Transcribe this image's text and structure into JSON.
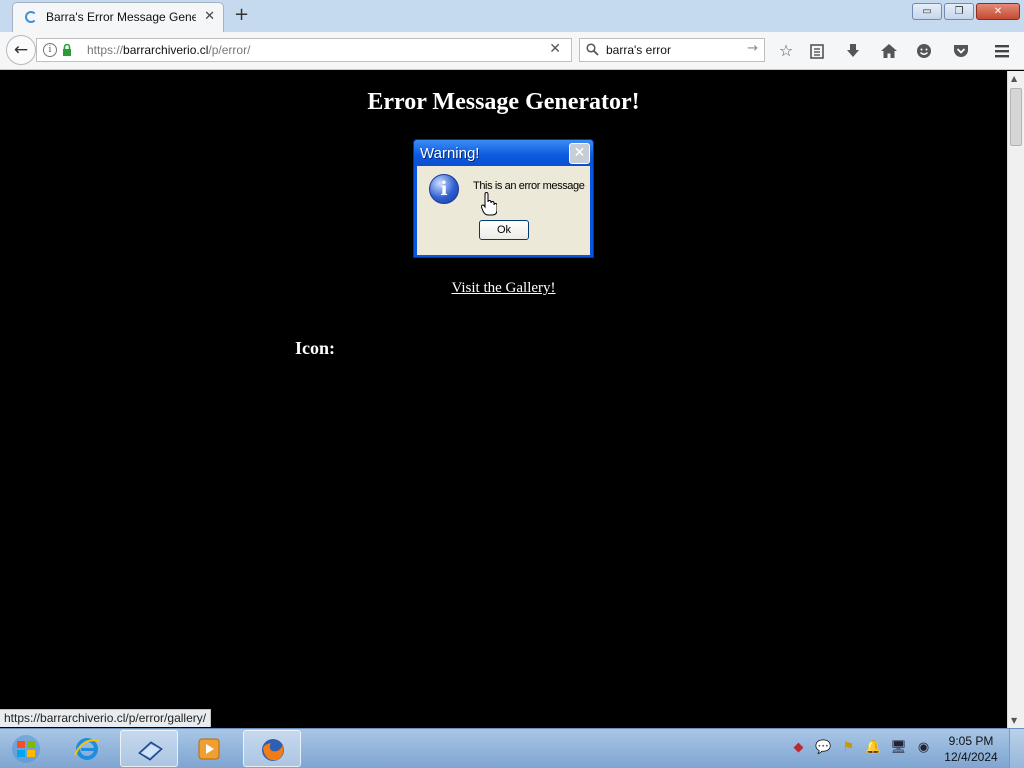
{
  "browser": {
    "tab": {
      "title": "Barra's Error Message Gene...",
      "close": "✕"
    },
    "new_tab": "+",
    "window_controls": {
      "minimize": "▭",
      "restore": "❐",
      "close": "✕"
    },
    "nav": {
      "back": "←",
      "url_prefix": "https://",
      "url_domain": "barrarchiverio.cl",
      "url_path": "/p/error/",
      "url_clear": "✕",
      "search_text": "barra's error",
      "search_go": "→"
    },
    "toolbar_icons": [
      "bookmark-star-icon",
      "reading-list-icon",
      "download-icon",
      "home-icon",
      "hello-icon",
      "pocket-icon",
      "menu-icon"
    ]
  },
  "page": {
    "title": "Error Message Generator!",
    "dialog": {
      "title": "Warning!",
      "close": "✕",
      "icon": "info-icon",
      "message": "This is an error message",
      "ok_label": "Ok"
    },
    "gallery_link": "Visit the Gallery!",
    "icon_label": "Icon:"
  },
  "status_bar": {
    "hover_url": "https://barrarchiverio.cl/p/error/gallery/"
  },
  "taskbar": {
    "apps": [
      "internet-explorer-icon",
      "server-manager-icon",
      "media-player-icon",
      "firefox-icon"
    ],
    "clock": {
      "time": "9:05 PM",
      "date": "12/4/2024"
    }
  },
  "colors": {
    "dialog_blue": "#0a55e0",
    "dialog_body": "#ece9d8",
    "page_bg": "#000000"
  }
}
